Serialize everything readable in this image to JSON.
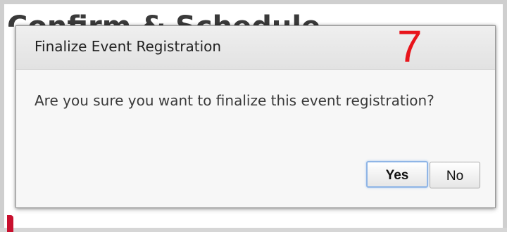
{
  "background": {
    "heading_partial": "Confirm & Schedule"
  },
  "dialog": {
    "title": "Finalize Event Registration",
    "message": "Are you sure you want to finalize this event registration?",
    "buttons": {
      "yes_label": "Yes",
      "no_label": "No"
    }
  },
  "annotation": {
    "step_number": "7",
    "color": "#e8141b"
  },
  "colors": {
    "accent_red": "#c8102e",
    "focus_ring": "#8fb5e6"
  }
}
